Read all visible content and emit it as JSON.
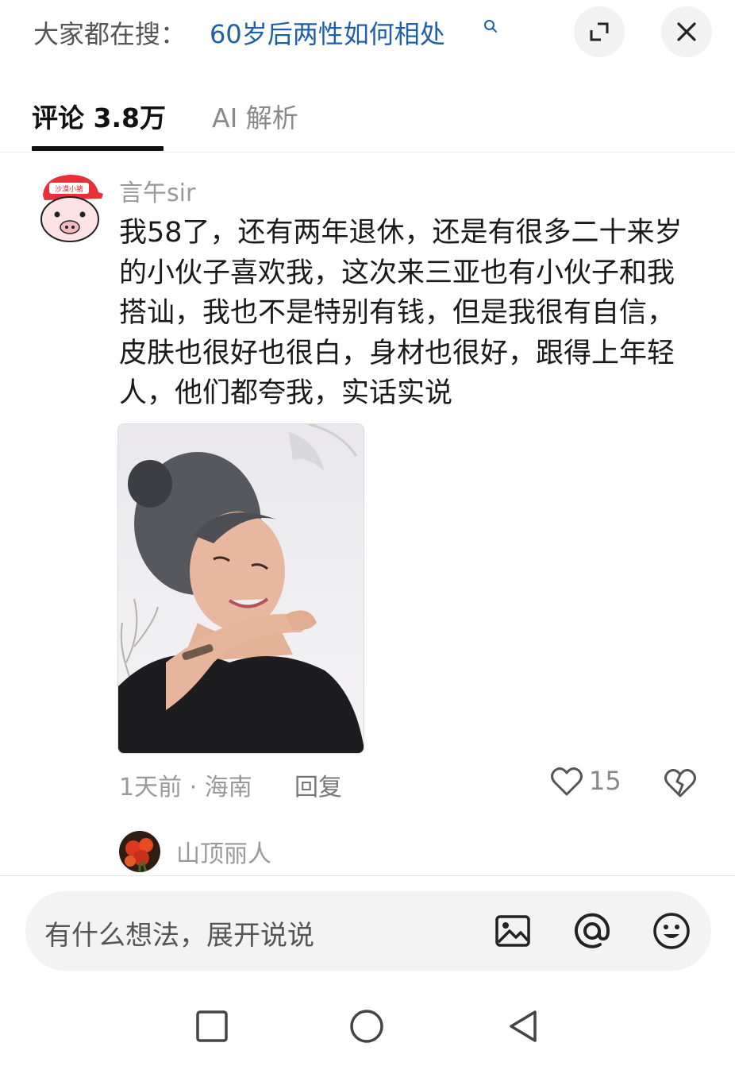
{
  "search_suggestion": {
    "prefix": "大家都在搜：",
    "query": "60岁后两性如何相处",
    "search_icon": "search-icon",
    "expand_icon": "expand-icon",
    "close_icon": "close-icon"
  },
  "tabs": [
    {
      "label": "评论 3.8万",
      "active": true
    },
    {
      "label": "AI 解析",
      "active": false
    }
  ],
  "comment": {
    "author": "言午sir",
    "avatar_badge": "沙漠小猪",
    "text": "我58了，还有两年退休，还是有很多二十来岁的小伙子喜欢我，这次来三亚也有小伙子和我搭讪，我也不是特别有钱，但是我很有自信，皮肤也很好也很白，身材也很好，跟得上年轻人，他们都夸我，实话实说",
    "meta": "1天前 · 海南",
    "reply_label": "回复",
    "like_count": "15",
    "like_icon": "heart-icon",
    "dislike_icon": "broken-heart-icon"
  },
  "next_comment": {
    "author": "山顶丽人"
  },
  "input": {
    "placeholder": "有什么想法，展开说说",
    "icons": [
      "image-icon",
      "at-icon",
      "emoji-icon"
    ]
  },
  "navbar": {
    "icons": [
      "recent-apps-icon",
      "home-icon",
      "back-icon"
    ]
  },
  "colors": {
    "query_link": "#1f5fa8",
    "muted_text": "#999999",
    "input_bg": "#f3f3f3"
  }
}
